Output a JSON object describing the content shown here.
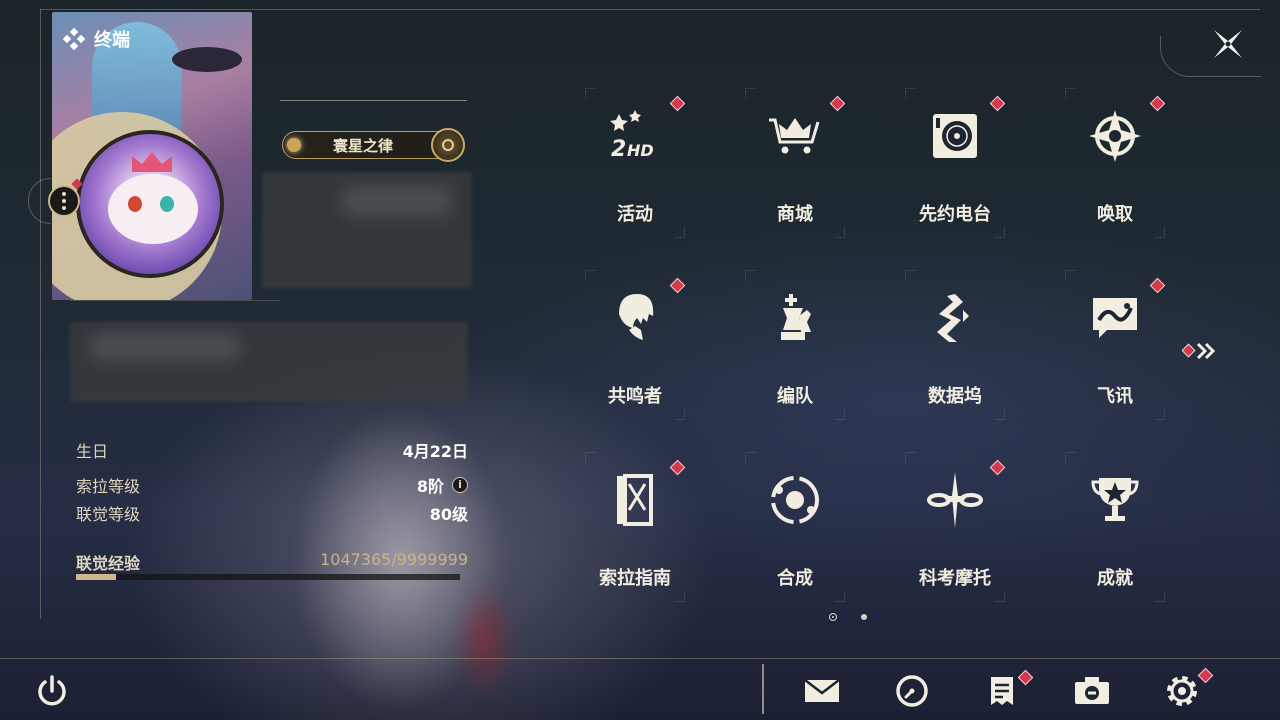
{
  "header": {
    "terminal_label": "终端",
    "close_icon": "close-x-icon"
  },
  "profile": {
    "title_badge": "寰星之律",
    "stats": [
      {
        "label": "生日",
        "value": "4月22日"
      },
      {
        "label": "索拉等级",
        "value": "8阶",
        "has_info": true
      },
      {
        "label": "联觉等级",
        "value": "80级"
      }
    ],
    "exp": {
      "label": "联觉经验",
      "value": "1047365/9999999",
      "progress": 0.105
    }
  },
  "grid": {
    "tiles": [
      {
        "label": "活动",
        "icon": "event-2hd-icon",
        "badge": true
      },
      {
        "label": "商城",
        "icon": "shop-crown-cart-icon",
        "badge": true
      },
      {
        "label": "先约电台",
        "icon": "pioneer-radio-icon",
        "badge": true
      },
      {
        "label": "唤取",
        "icon": "convene-compass-icon",
        "badge": true
      },
      {
        "label": "共鸣者",
        "icon": "resonator-portrait-icon",
        "badge": true
      },
      {
        "label": "编队",
        "icon": "team-chess-icon",
        "badge": false
      },
      {
        "label": "数据坞",
        "icon": "data-bank-icon",
        "badge": false
      },
      {
        "label": "飞讯",
        "icon": "message-bubble-icon",
        "badge": true
      },
      {
        "label": "索拉指南",
        "icon": "guidebook-icon",
        "badge": true
      },
      {
        "label": "合成",
        "icon": "synthesis-orbit-icon",
        "badge": false
      },
      {
        "label": "科考摩托",
        "icon": "motorbike-icon",
        "badge": true
      },
      {
        "label": "成就",
        "icon": "trophy-icon",
        "badge": false
      }
    ],
    "next_icon": "double-chevron-right-icon",
    "pages": 2,
    "current_page": 1
  },
  "bottom_bar": {
    "left": {
      "icon": "power-icon"
    },
    "right": [
      {
        "icon": "mail-icon",
        "badge": false
      },
      {
        "icon": "clock-icon",
        "badge": false
      },
      {
        "icon": "notes-icon",
        "badge": true
      },
      {
        "icon": "camera-icon",
        "badge": false
      },
      {
        "icon": "settings-gear-icon",
        "badge": true
      }
    ]
  },
  "colors": {
    "accent_gold": "#cdb88d",
    "badge_red": "#d13a4d",
    "text_primary": "#f2ede1"
  }
}
